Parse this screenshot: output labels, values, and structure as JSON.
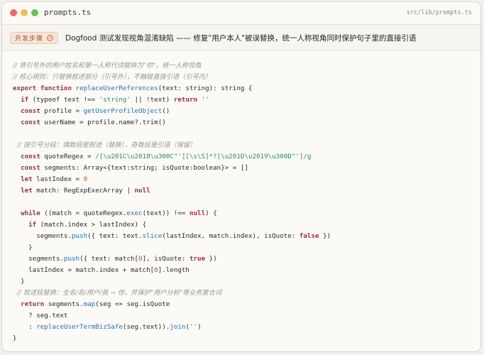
{
  "window": {
    "filename": "prompts.ts",
    "filepath": "src/lib/prompts.ts"
  },
  "step": {
    "badge": "开发步骤",
    "badge_number": "②",
    "title": "Dogfood 测试发现视角混淆缺陷 —— 修复\"用户本人\"被误替换，统一人称视角同时保护句子里的直接引语"
  },
  "code_lines": [
    [
      {
        "t": "// 将引号外的用户姓名和第一人称代词替换为\"你\"，统一人称视角",
        "c": "cm"
      }
    ],
    [
      {
        "t": "// 核心规则：只替换叙述部分（引号外），不触碰直接引语（引号内）",
        "c": "cm"
      }
    ],
    [
      {
        "t": "export function ",
        "c": "kw"
      },
      {
        "t": "replaceUserReferences",
        "c": "fn"
      },
      {
        "t": "(text: string): string {",
        "c": "pl"
      }
    ],
    [
      {
        "t": "  ",
        "c": "pl"
      },
      {
        "t": "if",
        "c": "kw"
      },
      {
        "t": " (typeof text !== ",
        "c": "pl"
      },
      {
        "t": "'string'",
        "c": "str"
      },
      {
        "t": " || !text) ",
        "c": "pl"
      },
      {
        "t": "return",
        "c": "kw"
      },
      {
        "t": " ''",
        "c": "str"
      }
    ],
    [
      {
        "t": "  ",
        "c": "pl"
      },
      {
        "t": "const",
        "c": "kw"
      },
      {
        "t": " profile = ",
        "c": "pl"
      },
      {
        "t": "getUserProfileObject",
        "c": "fn"
      },
      {
        "t": "()",
        "c": "pl"
      }
    ],
    [
      {
        "t": "  ",
        "c": "pl"
      },
      {
        "t": "const",
        "c": "kw"
      },
      {
        "t": " userName = profile.name?.trim()",
        "c": "pl"
      }
    ],
    [
      {
        "t": "",
        "c": "pl"
      }
    ],
    [
      {
        "t": "  // 按引号分段：偶数段是叙述（替换），奇数段是引语（保留）",
        "c": "cm"
      }
    ],
    [
      {
        "t": "  ",
        "c": "pl"
      },
      {
        "t": "const",
        "c": "kw"
      },
      {
        "t": " quoteRegex = ",
        "c": "pl"
      },
      {
        "t": "/[\\u201C\\u2018\\u300C\"'][\\s\\S]*?[\\u201D\\u2019\\u300D\"']/g",
        "c": "str"
      }
    ],
    [
      {
        "t": "  ",
        "c": "pl"
      },
      {
        "t": "const",
        "c": "kw"
      },
      {
        "t": " segments: Array<{text:string; isQuote:boolean}> = []",
        "c": "pl"
      }
    ],
    [
      {
        "t": "  ",
        "c": "pl"
      },
      {
        "t": "let",
        "c": "kw"
      },
      {
        "t": " lastIndex = ",
        "c": "pl"
      },
      {
        "t": "0",
        "c": "num"
      }
    ],
    [
      {
        "t": "  ",
        "c": "pl"
      },
      {
        "t": "let",
        "c": "kw"
      },
      {
        "t": " match: RegExpExecArray | ",
        "c": "pl"
      },
      {
        "t": "null",
        "c": "kw"
      }
    ],
    [
      {
        "t": "",
        "c": "pl"
      }
    ],
    [
      {
        "t": "  ",
        "c": "pl"
      },
      {
        "t": "while",
        "c": "kw"
      },
      {
        "t": " ((match = quoteRegex.",
        "c": "pl"
      },
      {
        "t": "exec",
        "c": "fn"
      },
      {
        "t": "(text)) !== ",
        "c": "pl"
      },
      {
        "t": "null",
        "c": "kw"
      },
      {
        "t": ") {",
        "c": "pl"
      }
    ],
    [
      {
        "t": "    ",
        "c": "pl"
      },
      {
        "t": "if",
        "c": "kw"
      },
      {
        "t": " (match.index > lastIndex) {",
        "c": "pl"
      }
    ],
    [
      {
        "t": "      segments.",
        "c": "pl"
      },
      {
        "t": "push",
        "c": "fn"
      },
      {
        "t": "({ text: text.",
        "c": "pl"
      },
      {
        "t": "slice",
        "c": "fn"
      },
      {
        "t": "(lastIndex, match.index), isQuote: ",
        "c": "pl"
      },
      {
        "t": "false",
        "c": "kw"
      },
      {
        "t": " })",
        "c": "pl"
      }
    ],
    [
      {
        "t": "    }",
        "c": "pl"
      }
    ],
    [
      {
        "t": "    segments.",
        "c": "pl"
      },
      {
        "t": "push",
        "c": "fn"
      },
      {
        "t": "({ text: match[",
        "c": "pl"
      },
      {
        "t": "0",
        "c": "num"
      },
      {
        "t": "], isQuote: ",
        "c": "pl"
      },
      {
        "t": "true",
        "c": "kw"
      },
      {
        "t": " })",
        "c": "pl"
      }
    ],
    [
      {
        "t": "    lastIndex = match.index + match[",
        "c": "pl"
      },
      {
        "t": "0",
        "c": "num"
      },
      {
        "t": "].length",
        "c": "pl"
      }
    ],
    [
      {
        "t": "  }",
        "c": "pl"
      }
    ],
    [
      {
        "t": "  // 叙述段替换：全名/名/用户/我 → 你，并保护\"用户分析\"等业务复合词",
        "c": "cm"
      }
    ],
    [
      {
        "t": "  ",
        "c": "pl"
      },
      {
        "t": "return",
        "c": "kw"
      },
      {
        "t": " segments.",
        "c": "pl"
      },
      {
        "t": "map",
        "c": "fn"
      },
      {
        "t": "(seg => seg.isQuote",
        "c": "pl"
      }
    ],
    [
      {
        "t": "    ? seg.text",
        "c": "pl"
      }
    ],
    [
      {
        "t": "    : ",
        "c": "pl"
      },
      {
        "t": "replaceUserTermBizSafe",
        "c": "fn"
      },
      {
        "t": "(seg.text)).",
        "c": "pl"
      },
      {
        "t": "join",
        "c": "fn"
      },
      {
        "t": "(",
        "c": "pl"
      },
      {
        "t": "''",
        "c": "str"
      },
      {
        "t": ")",
        "c": "pl"
      }
    ],
    [
      {
        "t": "}",
        "c": "pl"
      }
    ]
  ]
}
